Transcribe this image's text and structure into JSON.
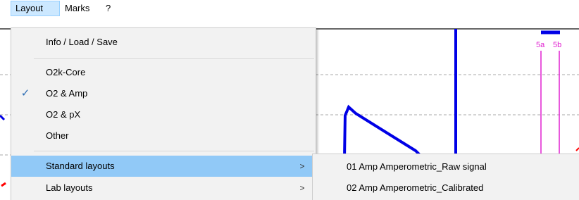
{
  "menubar": {
    "items": [
      {
        "label": "Layout"
      },
      {
        "label": "Marks"
      },
      {
        "label": "?"
      }
    ]
  },
  "layout_menu": {
    "info_load_save": "Info / Load / Save",
    "options": [
      {
        "label": "O2k-Core",
        "checked": false
      },
      {
        "label": "O2 & Amp",
        "checked": true
      },
      {
        "label": "O2 & pX",
        "checked": false
      },
      {
        "label": "Other",
        "checked": false
      }
    ],
    "check_glyph": "✓",
    "standard_layouts": "Standard layouts",
    "lab_layouts": "Lab layouts",
    "submenu_arrow": ">"
  },
  "standard_layouts_submenu": {
    "items": [
      {
        "label": "01 Amp Amperometric_Raw signal"
      },
      {
        "label": "02 Amp Amperometric_Calibrated"
      }
    ]
  },
  "plot": {
    "marks": [
      {
        "label": "5a"
      },
      {
        "label": "5b"
      }
    ],
    "colors": {
      "trace": "#0000e6",
      "mark": "#e020d0",
      "red": "#ff0000",
      "grid": "#aaaaaa",
      "highlight": "#91c9f7",
      "menubar_active": "#cce8ff"
    }
  }
}
